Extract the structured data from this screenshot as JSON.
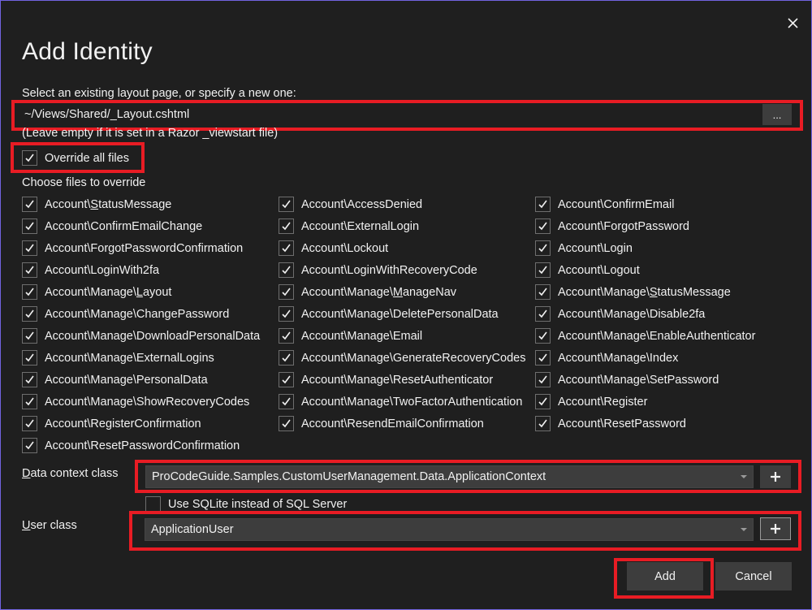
{
  "dialog": {
    "title": "Add Identity",
    "close_icon": "close-icon",
    "highlight_color": "#e81c24",
    "accent_border_color": "#7163e0"
  },
  "layout": {
    "label": "Select an existing layout page, or specify a new one:",
    "value": "~/Views/Shared/_Layout.cshtml",
    "browse_label": "...",
    "hint": "(Leave empty if it is set in a Razor _viewstart file)"
  },
  "override_all": {
    "label": "Override all files",
    "checked": true
  },
  "files": {
    "heading": "Choose files to override",
    "columns": [
      [
        {
          "prefix": "Account\\",
          "accel": "S",
          "rest": "tatusMessage",
          "checked": true
        },
        {
          "prefix": "Account\\ConfirmEmailChange",
          "accel": "",
          "rest": "",
          "checked": true
        },
        {
          "prefix": "Account\\ForgotPasswordConfirmation",
          "accel": "",
          "rest": "",
          "checked": true
        },
        {
          "prefix": "Account\\LoginWith2fa",
          "accel": "",
          "rest": "",
          "checked": true
        },
        {
          "prefix": "Account\\Manage\\",
          "accel": "L",
          "rest": "ayout",
          "checked": true
        },
        {
          "prefix": "Account\\Manage\\ChangePassword",
          "accel": "",
          "rest": "",
          "checked": true
        },
        {
          "prefix": "Account\\Manage\\DownloadPersonalData",
          "accel": "",
          "rest": "",
          "checked": true
        },
        {
          "prefix": "Account\\Manage\\ExternalLogins",
          "accel": "",
          "rest": "",
          "checked": true
        },
        {
          "prefix": "Account\\Manage\\PersonalData",
          "accel": "",
          "rest": "",
          "checked": true
        },
        {
          "prefix": "Account\\Manage\\ShowRecoveryCodes",
          "accel": "",
          "rest": "",
          "checked": true
        },
        {
          "prefix": "Account\\RegisterConfirmation",
          "accel": "",
          "rest": "",
          "checked": true
        },
        {
          "prefix": "Account\\ResetPasswordConfirmation",
          "accel": "",
          "rest": "",
          "checked": true
        }
      ],
      [
        {
          "prefix": "Account\\AccessDenied",
          "accel": "",
          "rest": "",
          "checked": true
        },
        {
          "prefix": "Account\\ExternalLogin",
          "accel": "",
          "rest": "",
          "checked": true
        },
        {
          "prefix": "Account\\Lockout",
          "accel": "",
          "rest": "",
          "checked": true
        },
        {
          "prefix": "Account\\LoginWithRecoveryCode",
          "accel": "",
          "rest": "",
          "checked": true
        },
        {
          "prefix": "Account\\Manage\\",
          "accel": "M",
          "rest": "anageNav",
          "checked": true
        },
        {
          "prefix": "Account\\Manage\\DeletePersonalData",
          "accel": "",
          "rest": "",
          "checked": true
        },
        {
          "prefix": "Account\\Manage\\Email",
          "accel": "",
          "rest": "",
          "checked": true
        },
        {
          "prefix": "Account\\Manage\\GenerateRecoveryCodes",
          "accel": "",
          "rest": "",
          "checked": true
        },
        {
          "prefix": "Account\\Manage\\ResetAuthenticator",
          "accel": "",
          "rest": "",
          "checked": true
        },
        {
          "prefix": "Account\\Manage\\TwoFactorAuthentication",
          "accel": "",
          "rest": "",
          "checked": true
        },
        {
          "prefix": "Account\\ResendEmailConfirmation",
          "accel": "",
          "rest": "",
          "checked": true
        }
      ],
      [
        {
          "prefix": "Account\\ConfirmEmail",
          "accel": "",
          "rest": "",
          "checked": true
        },
        {
          "prefix": "Account\\ForgotPassword",
          "accel": "",
          "rest": "",
          "checked": true
        },
        {
          "prefix": "Account\\Login",
          "accel": "",
          "rest": "",
          "checked": true
        },
        {
          "prefix": "Account\\Logout",
          "accel": "",
          "rest": "",
          "checked": true
        },
        {
          "prefix": "Account\\Manage\\",
          "accel": "S",
          "rest": "tatusMessage",
          "checked": true
        },
        {
          "prefix": "Account\\Manage\\Disable2fa",
          "accel": "",
          "rest": "",
          "checked": true
        },
        {
          "prefix": "Account\\Manage\\EnableAuthenticator",
          "accel": "",
          "rest": "",
          "checked": true
        },
        {
          "prefix": "Account\\Manage\\Index",
          "accel": "",
          "rest": "",
          "checked": true
        },
        {
          "prefix": "Account\\Manage\\SetPassword",
          "accel": "",
          "rest": "",
          "checked": true
        },
        {
          "prefix": "Account\\Register",
          "accel": "",
          "rest": "",
          "checked": true
        },
        {
          "prefix": "Account\\ResetPassword",
          "accel": "",
          "rest": "",
          "checked": true
        }
      ]
    ]
  },
  "data_context": {
    "label_accel": "D",
    "label_rest": "ata context class",
    "value": "ProCodeGuide.Samples.CustomUserManagement.Data.ApplicationContext",
    "add_icon": "plus-icon"
  },
  "sqlite": {
    "label": "Use SQLite instead of SQL Server",
    "checked": false
  },
  "user_class": {
    "label_accel": "U",
    "label_rest": "ser class",
    "value": "ApplicationUser",
    "add_icon": "plus-icon"
  },
  "buttons": {
    "add": "Add",
    "cancel": "Cancel"
  }
}
